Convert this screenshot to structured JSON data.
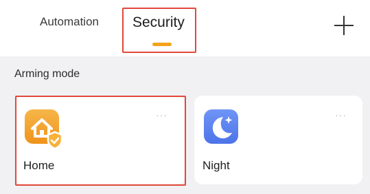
{
  "tabs": [
    {
      "label": "Automation",
      "active": false
    },
    {
      "label": "Security",
      "active": true
    }
  ],
  "colors": {
    "accent": "#f3a21a",
    "highlight_outline": "#e1473b",
    "night_icon": "#5a82f0",
    "home_icon": "#f4a32a"
  },
  "add_icon": "plus-icon",
  "section": {
    "title": "Arming mode"
  },
  "modes": [
    {
      "label": "Home",
      "icon": "home-shield-icon",
      "more": "···",
      "selected": true
    },
    {
      "label": "Night",
      "icon": "moon-icon",
      "more": "···",
      "selected": false
    }
  ]
}
